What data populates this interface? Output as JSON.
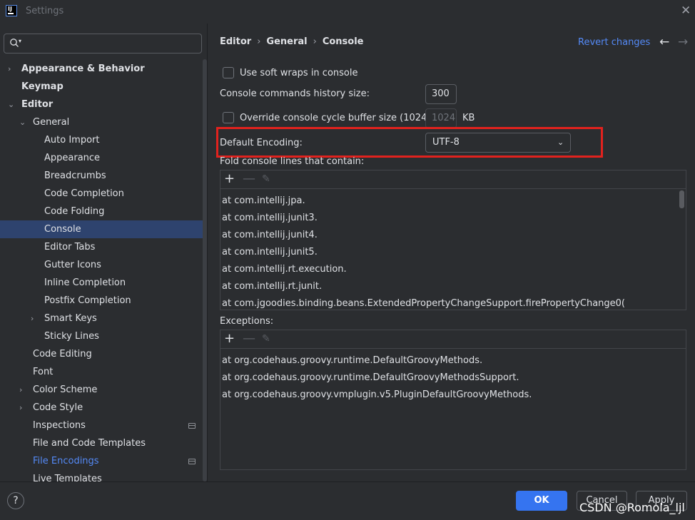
{
  "window": {
    "title": "Settings",
    "app_icon_text": "IJ"
  },
  "sidebar": {
    "search_placeholder": "",
    "items": [
      {
        "label": "Appearance & Behavior",
        "chevron": "›",
        "bold": true
      },
      {
        "label": "Keymap",
        "chevron": "",
        "bold": true
      },
      {
        "label": "Editor",
        "chevron": "⌄",
        "bold": true
      },
      {
        "label": "General",
        "chevron": "⌄"
      },
      {
        "label": "Auto Import"
      },
      {
        "label": "Appearance"
      },
      {
        "label": "Breadcrumbs"
      },
      {
        "label": "Code Completion"
      },
      {
        "label": "Code Folding"
      },
      {
        "label": "Console",
        "selected": true
      },
      {
        "label": "Editor Tabs"
      },
      {
        "label": "Gutter Icons"
      },
      {
        "label": "Inline Completion"
      },
      {
        "label": "Postfix Completion"
      },
      {
        "label": "Smart Keys",
        "chevron": "›"
      },
      {
        "label": "Sticky Lines"
      },
      {
        "label": "Code Editing"
      },
      {
        "label": "Font"
      },
      {
        "label": "Color Scheme",
        "chevron": "›"
      },
      {
        "label": "Code Style",
        "chevron": "›"
      },
      {
        "label": "Inspections",
        "icon": "project-scope-icon"
      },
      {
        "label": "File and Code Templates"
      },
      {
        "label": "File Encodings",
        "link": true,
        "icon": "project-scope-icon"
      },
      {
        "label": "Live Templates"
      }
    ]
  },
  "header": {
    "breadcrumb": [
      "Editor",
      "General",
      "Console"
    ],
    "breadcrumb_sep": "›",
    "revert": "Revert changes",
    "back_icon": "←",
    "forward_icon": "→"
  },
  "settings": {
    "soft_wraps_label": "Use soft wraps in console",
    "history_label": "Console commands history size:",
    "history_value": "300",
    "cycle_buffer_label": "Override console cycle buffer size (1024 KB)",
    "cycle_buffer_value": "1024",
    "cycle_buffer_unit": "KB",
    "encoding_label": "Default Encoding:",
    "encoding_value": "UTF-8",
    "fold_label": "Fold console lines that contain:",
    "fold_lines": [
      "at com.intellij.jpa.",
      "at com.intellij.junit3.",
      "at com.intellij.junit4.",
      "at com.intellij.junit5.",
      "at com.intellij.rt.execution.",
      "at com.intellij.rt.junit.",
      "at com.jgoodies.binding.beans.ExtendedPropertyChangeSupport.firePropertyChange0("
    ],
    "exceptions_label": "Exceptions:",
    "exception_lines": [
      "at org.codehaus.groovy.runtime.DefaultGroovyMethods.",
      "at org.codehaus.groovy.runtime.DefaultGroovyMethodsSupport.",
      "at org.codehaus.groovy.vmplugin.v5.PluginDefaultGroovyMethods."
    ],
    "toolbar": {
      "add": "+",
      "remove": "—",
      "edit": "✎"
    }
  },
  "footer": {
    "help": "?",
    "ok": "OK",
    "cancel": "Cancel",
    "apply": "Apply",
    "watermark": "CSDN @Romola_ljl"
  },
  "colors": {
    "accent": "#3574f0",
    "link": "#548af7",
    "selection": "#2e436e",
    "highlight_box": "#e1221e"
  }
}
